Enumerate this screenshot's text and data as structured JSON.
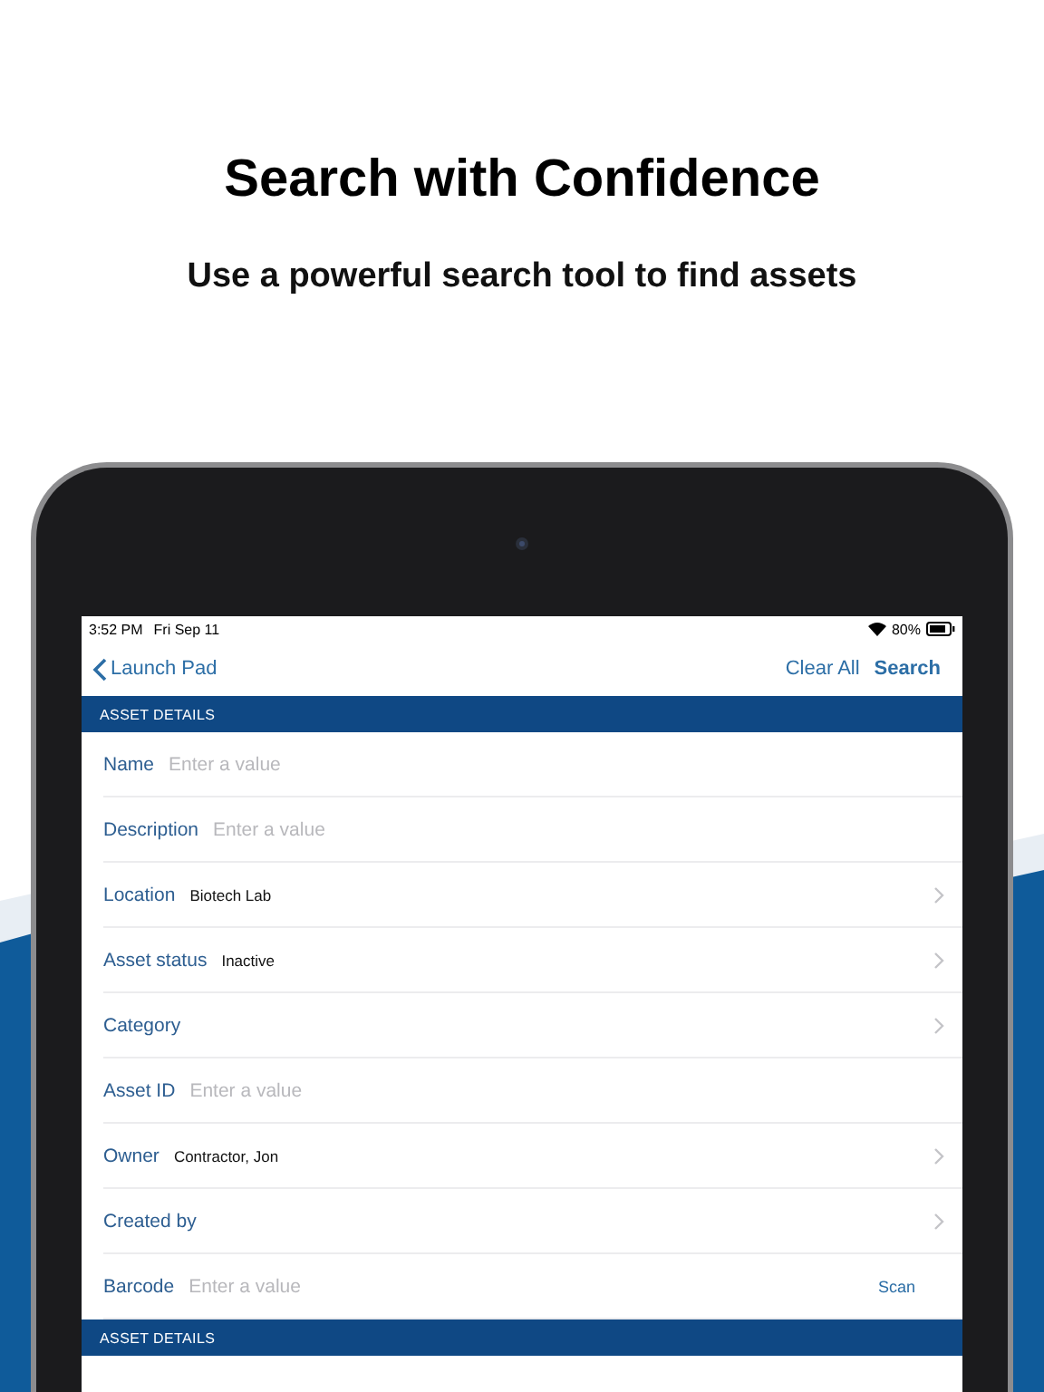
{
  "headline": "Search with Confidence",
  "subheadline": "Use a powerful search tool to find assets",
  "status_bar": {
    "time": "3:52 PM",
    "date": "Fri Sep 11",
    "battery": "80%"
  },
  "nav_bar": {
    "back": "Launch Pad",
    "actions": [
      {
        "label": "Clear All",
        "primary": false
      },
      {
        "label": "Search",
        "primary": true
      }
    ]
  },
  "sections": [
    {
      "title": "ASSET DETAILS",
      "fields": [
        {
          "kind": "text",
          "label": "Name",
          "placeholder": "Enter a value"
        },
        {
          "kind": "text",
          "label": "Description",
          "placeholder": "Enter a value"
        },
        {
          "kind": "select",
          "label": "Location",
          "value": "Biotech Lab"
        },
        {
          "kind": "select",
          "label": "Asset status",
          "value": "Inactive"
        },
        {
          "kind": "select",
          "label": "Category"
        },
        {
          "kind": "text",
          "label": "Asset ID",
          "placeholder": "Enter a value"
        },
        {
          "kind": "select",
          "label": "Owner",
          "value": "Contractor, Jon"
        },
        {
          "kind": "select",
          "label": "Created by"
        },
        {
          "kind": "scan",
          "label": "Barcode",
          "placeholder": "Enter a value",
          "action": "Scan"
        }
      ]
    },
    {
      "title": "ASSET DETAILS"
    }
  ]
}
